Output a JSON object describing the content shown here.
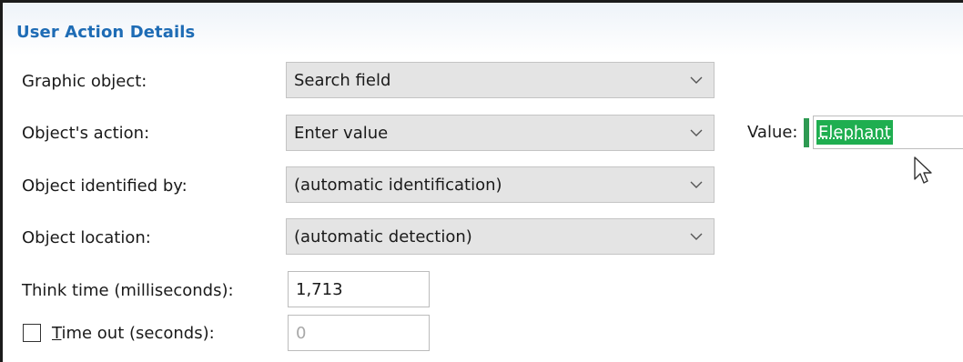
{
  "section": {
    "title": "User Action Details"
  },
  "fields": {
    "graphic_object": {
      "label": "Graphic object:",
      "value": "Search field"
    },
    "objects_action": {
      "label": "Object's action:",
      "value": "Enter value"
    },
    "identified_by": {
      "label": "Object identified by:",
      "value": "(automatic identification)"
    },
    "location": {
      "label": "Object location:",
      "value": "(automatic detection)"
    },
    "think_time": {
      "label": "Think time (milliseconds):",
      "value": "1,713"
    },
    "time_out": {
      "label_mnemonic": "T",
      "label_rest": "ime out (seconds):",
      "value": "0",
      "checked": false,
      "disabled": true
    }
  },
  "value_field": {
    "label": "Value:",
    "text": "Elephant",
    "selection_color": "#1fae50"
  },
  "icons": {
    "combo": "chevron-down-icon",
    "pointer": "mouse-pointer-icon"
  },
  "colors": {
    "title": "#1e6cb5",
    "combo_bg": "#e4e4e4"
  }
}
